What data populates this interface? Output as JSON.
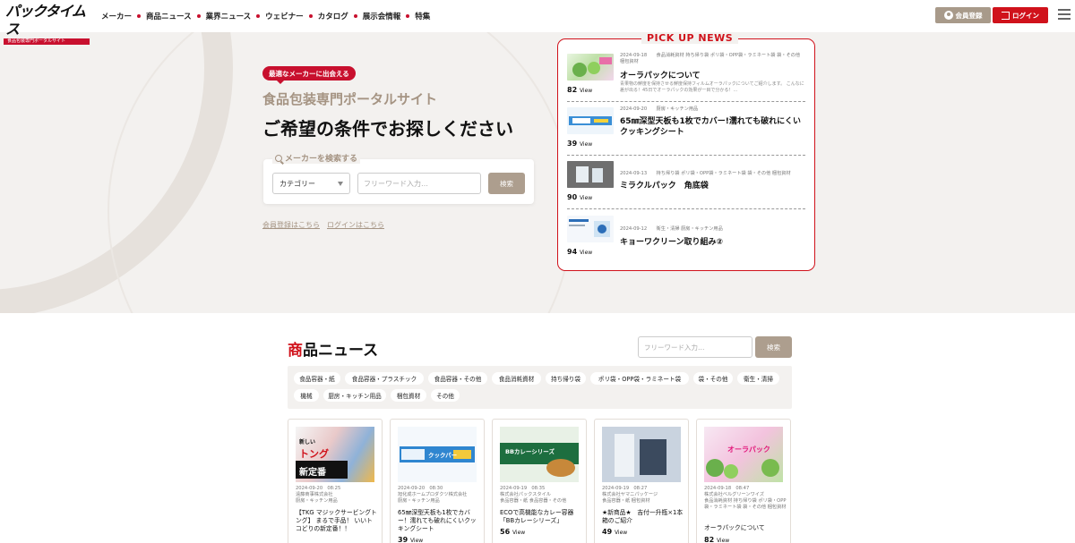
{
  "header": {
    "logo_text": "パックタイムス",
    "logo_sub": "食品包装専門ポータルサイト",
    "nav": [
      "メーカー",
      "商品ニュース",
      "業界ニュース",
      "ウェビナー",
      "カタログ",
      "展示会情報",
      "特集"
    ],
    "register_label": "会員登録",
    "login_label": "ログイン"
  },
  "hero": {
    "tagline": "最適なメーカーに出会える",
    "subtitle": "食品包装専門ポータルサイト",
    "title": "ご希望の条件でお探しください",
    "search_label": "メーカーを検索する",
    "category_value": "カテゴリー",
    "free_placeholder": "フリーワード入力…",
    "search_button": "検索",
    "register_link": "会員登録はこちら",
    "login_link": "ログインはこちら"
  },
  "pickup": {
    "title": "PICK UP NEWS",
    "items": [
      {
        "date": "2024-09-18",
        "meta": "2024-09-18　　食品消耗資材 持ち帰り袋 ポリ袋・OPP袋・ラミネート袋 袋・その他 梱包資材",
        "title": "オーラパックについて",
        "desc": "青果物の鮮度を保持させる鮮度保持フィルムオーラパックについてご紹介します。 こんなに差が出る！45日でオーラパックの効果が一目で分かる！…",
        "views": "82",
        "views_unit": "View"
      },
      {
        "meta": "2024-09-20　　厨房・キッチン用品",
        "title": "65㎜深型天板も1枚でカバー!濡れても破れにくいクッキングシート",
        "views": "39",
        "views_unit": "View"
      },
      {
        "meta": "2024-09-13　　持ち帰り袋 ポリ袋・OPP袋・ラミネート袋 袋・その他 梱包資材",
        "title": "ミラクルパック　角底袋",
        "views": "90",
        "views_unit": "View"
      },
      {
        "meta": "2024-09-12　　衛生・清掃 厨房・キッチン用品",
        "title": "キョーワクリーン取り組み②",
        "views": "94",
        "views_unit": "View"
      }
    ]
  },
  "news": {
    "title_first": "商",
    "title_rest": "品ニュース",
    "search_placeholder": "フリーワード入力…",
    "search_button": "検索",
    "tags": [
      "食品容器・紙",
      "食品容器・プラスチック",
      "食品容器・その他",
      "食品消耗資材",
      "持ち帰り袋",
      "ポリ袋・OPP袋・ラミネート袋",
      "袋・その他",
      "衛生・清掃",
      "機械",
      "厨房・キッチン用品",
      "梱包資材",
      "その他"
    ],
    "cards": [
      {
        "datetime": "2024-09-20　08:25",
        "company": "遠藤商事株式会社",
        "category": "厨房・キッチン用品",
        "title": "【TKG マジックサービングトング】 まるで手品！ いいトコどりの新定番！！",
        "views": "",
        "img_text1": "新しい",
        "img_text2": "トング",
        "img_text3": "新定番"
      },
      {
        "datetime": "2024-09-20　08:30",
        "company": "旭化成ホームプロダクツ株式会社",
        "category": "厨房・キッチン用品",
        "title": "65㎜深型天板も1枚でカバー！濡れても破れにくいクッキングシート",
        "views": "39",
        "img_text1": "クックパー"
      },
      {
        "datetime": "2024-09-19　08:35",
        "company": "株式会社パックスタイル",
        "category": "食品容器・紙 食品容器・その他",
        "title": "ECOで高機能なカレー容器「BBカレーシリーズ」",
        "views": "56",
        "img_text1": "BBカレーシリーズ"
      },
      {
        "datetime": "2024-09-19　08:27",
        "company": "株式会社ヤマニパッケージ",
        "category": "食品容器・紙 梱包資材",
        "title": "★新商品★　吉付一升瓶×1本箱のご紹介",
        "views": "49"
      },
      {
        "datetime": "2024-09-18　08:47",
        "company": "株式会社ベルグリーンワイズ",
        "category": "食品消耗資材 持ち帰り袋 ポリ袋・OPP袋・ラミネート袋 袋・その他 梱包資材",
        "title": "オーラパックについて",
        "views": "82",
        "img_text1": "オーラパック"
      }
    ],
    "views_unit": "View"
  },
  "colors": {
    "brand_red": "#d0121b",
    "accent_beige": "#ad9e8e",
    "hero_bg": "#f3f1ef"
  }
}
